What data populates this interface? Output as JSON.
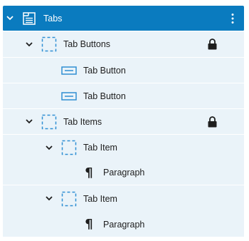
{
  "tree": {
    "root": {
      "label": "Tabs",
      "icon": "tabs-block-icon",
      "expanded": true
    },
    "tab_buttons": {
      "label": "Tab Buttons",
      "icon": "dashed-square-icon",
      "expanded": true,
      "locked": true
    },
    "tab_button_1": {
      "label": "Tab Button",
      "icon": "button-icon"
    },
    "tab_button_2": {
      "label": "Tab Button",
      "icon": "button-icon"
    },
    "tab_items": {
      "label": "Tab Items",
      "icon": "dashed-square-icon",
      "expanded": true,
      "locked": true
    },
    "tab_item_1": {
      "label": "Tab Item",
      "icon": "dashed-square-icon",
      "expanded": true
    },
    "paragraph_1": {
      "label": "Paragraph",
      "icon": "pilcrow-icon"
    },
    "tab_item_2": {
      "label": "Tab Item",
      "icon": "dashed-square-icon",
      "expanded": true
    },
    "paragraph_2": {
      "label": "Paragraph",
      "icon": "pilcrow-icon"
    }
  },
  "colors": {
    "selected_bg": "#0a7bbf",
    "row_bg": "#eaf3f9",
    "accent_icon": "#2f8fd3",
    "text": "#1e1e1e"
  }
}
